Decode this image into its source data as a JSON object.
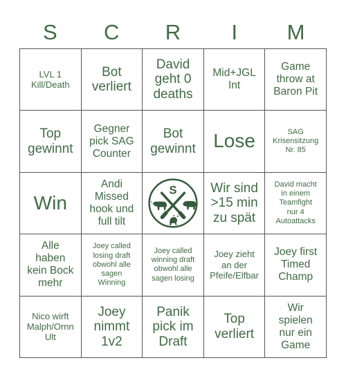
{
  "header": {
    "letters": [
      "S",
      "C",
      "R",
      "I",
      "M"
    ]
  },
  "colors": {
    "text_green": "#416b44",
    "grid_line": "#555555",
    "background": "#ffffff"
  },
  "grid": {
    "columns": 5,
    "rows": 5,
    "cells": [
      {
        "text": "LVL 1\nKill/Death",
        "size": "sm"
      },
      {
        "text": "Bot\nverliert",
        "size": "lg"
      },
      {
        "text": "David\ngeht 0\ndeaths",
        "size": "lg"
      },
      {
        "text": "Mid+JGL\nInt",
        "size": "md"
      },
      {
        "text": "Game\nthrow at\nBaron Pit",
        "size": "md"
      },
      {
        "text": "Top\ngewinnt",
        "size": "lg"
      },
      {
        "text": "Gegner\npick SAG\nCounter",
        "size": "md"
      },
      {
        "text": "Bot\ngewinnt",
        "size": "lg"
      },
      {
        "text": "Lose",
        "size": "xl"
      },
      {
        "text": "SAG\nKrisensitzung\nNr. 85",
        "size": "xs"
      },
      {
        "text": "Win",
        "size": "xl"
      },
      {
        "text": "Andi\nMissed\nhook und\nfull tilt",
        "size": "md"
      },
      {
        "text": "",
        "size": "logo",
        "icon": "scrim-butcher-logo"
      },
      {
        "text": "Wir sind\n>15 min\nzu spät",
        "size": "lg"
      },
      {
        "text": "David macht\nin einem\nTeamfight\nnur 4\nAutoattacks",
        "size": "xs"
      },
      {
        "text": "Alle\nhaben\nkein Bock\nmehr",
        "size": "md"
      },
      {
        "text": "Joey called\nlosing draft\nobwohl alle\nsagen\nWinning",
        "size": "xs"
      },
      {
        "text": "Joey called\nwinning draft\nobwohl alle\nsagen losing",
        "size": "xs"
      },
      {
        "text": "Joey zieht\nan der\nPfeife/Elfbar",
        "size": "sm"
      },
      {
        "text": "Joey first\nTimed\nChamp",
        "size": "md"
      },
      {
        "text": "Nico wirft\nMalph/Ornn\nUlt",
        "size": "sm"
      },
      {
        "text": "Joey\nnimmt\n1v2",
        "size": "lg"
      },
      {
        "text": "Panik\npick im\nDraft",
        "size": "lg"
      },
      {
        "text": "Top\nverliert",
        "size": "lg"
      },
      {
        "text": "Wir\nspielen\nnur ein\nGame",
        "size": "md"
      }
    ]
  },
  "logo": {
    "letter": "S",
    "animals": [
      "cow",
      "pig",
      "chicken"
    ],
    "elements": [
      "circle-border",
      "crossed-knives"
    ]
  }
}
